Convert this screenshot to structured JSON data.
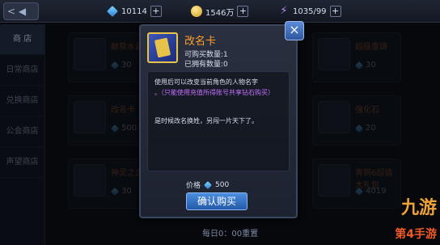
{
  "topbar": {
    "back_label": "< ◀",
    "gems": "10114",
    "gold": "1546万",
    "energy": "1035/99"
  },
  "sidebar": {
    "items": [
      {
        "label": "商 店"
      },
      {
        "label": "日常商店"
      },
      {
        "label": "兑换商店"
      },
      {
        "label": "公会商店"
      },
      {
        "label": "声望商店"
      }
    ]
  },
  "grid": {
    "items": [
      {
        "name": "献祭水晶",
        "price": "30"
      },
      {
        "name": "改名卡",
        "price": "500"
      },
      {
        "name": "神灵之血",
        "price": "30"
      },
      {
        "name": "超级重铸",
        "price": "30"
      },
      {
        "name": "强化石",
        "price": "20"
      },
      {
        "name": "青铜6超值大礼包",
        "price": "4019"
      }
    ]
  },
  "modal": {
    "title": "改名卡",
    "buyable": "可购买数量:1",
    "owned": "已拥有数量:0",
    "desc1": "使用后可以改变当前角色的人物名字",
    "desc2": "。（只能使用充值所得账号共享钻石购买）",
    "desc3": "是时候改名换姓，另闯一片天下了。",
    "price_label": "价格",
    "price_value": "500",
    "buy_label": "确认购买",
    "close_label": "×"
  },
  "footer": {
    "text": "每日0：00重置"
  },
  "watermark": {
    "logo": "九游",
    "text": "第4手游"
  }
}
